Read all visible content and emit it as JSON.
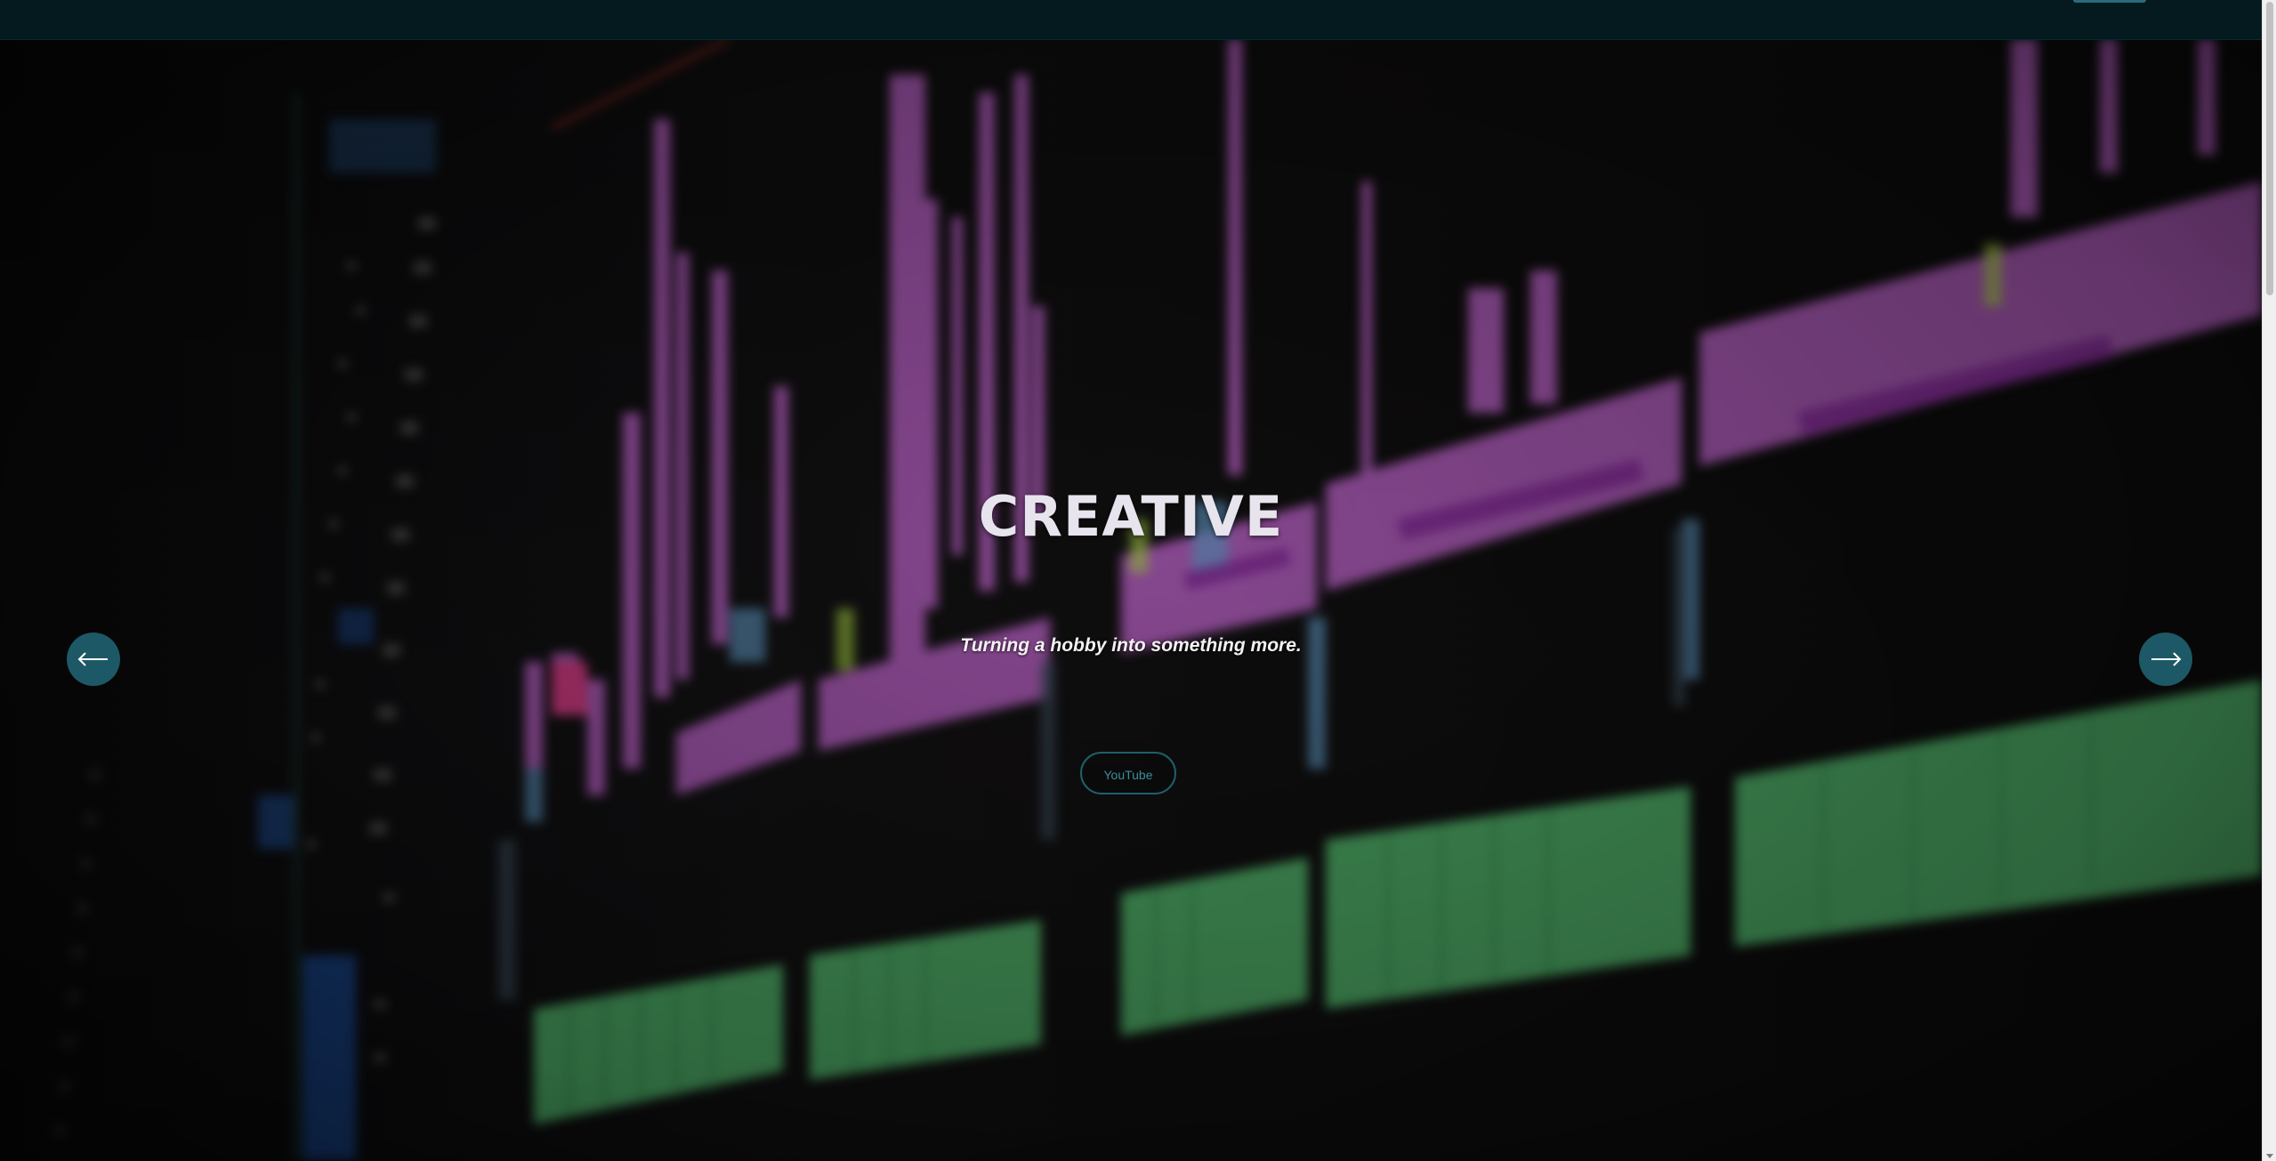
{
  "hero": {
    "title": "CREATIVE",
    "subtitle": "Turning a hobby into something more.",
    "button_label": "YouTube"
  },
  "carousel": {
    "prev_icon": "arrow-left-icon",
    "next_icon": "arrow-right-icon"
  },
  "colors": {
    "topbar": "#041a1f",
    "accent": "#1d5866",
    "button_text": "#3c8c9a",
    "clip_pink": "#c267cf",
    "clip_green": "#5fd27c"
  }
}
